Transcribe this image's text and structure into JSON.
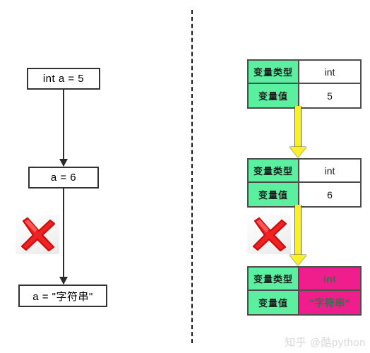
{
  "left_flow": {
    "title": "static-typed-language-flow",
    "steps": [
      {
        "label": "int a = 5"
      },
      {
        "label": "a = 6"
      },
      {
        "label": "a = \"字符串\""
      }
    ],
    "error_icon": "red-cross-icon"
  },
  "right_memory": {
    "title": "variable-memory-tables",
    "tables": [
      {
        "rows": [
          {
            "label": "变量类型",
            "value": "int",
            "value_style": "white"
          },
          {
            "label": "变量值",
            "value": "5",
            "value_style": "white"
          }
        ]
      },
      {
        "rows": [
          {
            "label": "变量类型",
            "value": "int",
            "value_style": "white"
          },
          {
            "label": "变量值",
            "value": "6",
            "value_style": "white"
          }
        ]
      },
      {
        "rows": [
          {
            "label": "变量类型",
            "value": "int",
            "value_style": "pink"
          },
          {
            "label": "变量值",
            "value": "\"字符串\"",
            "value_style": "pink"
          }
        ]
      }
    ],
    "error_icon": "red-cross-icon"
  },
  "colors": {
    "label_green": "#5bf0a0",
    "value_pink": "#f01e8c",
    "pink_text_green": "#1f7a47",
    "arrow_yellow": "#f7f02a",
    "arrow_yellow_border": "#6b6b2a",
    "box_border": "#333333",
    "table_border": "#4d4d4d",
    "divider": "#1a1a1a",
    "cross_red": "#e01b1b"
  },
  "watermark": {
    "text": "知乎 @酷python"
  }
}
